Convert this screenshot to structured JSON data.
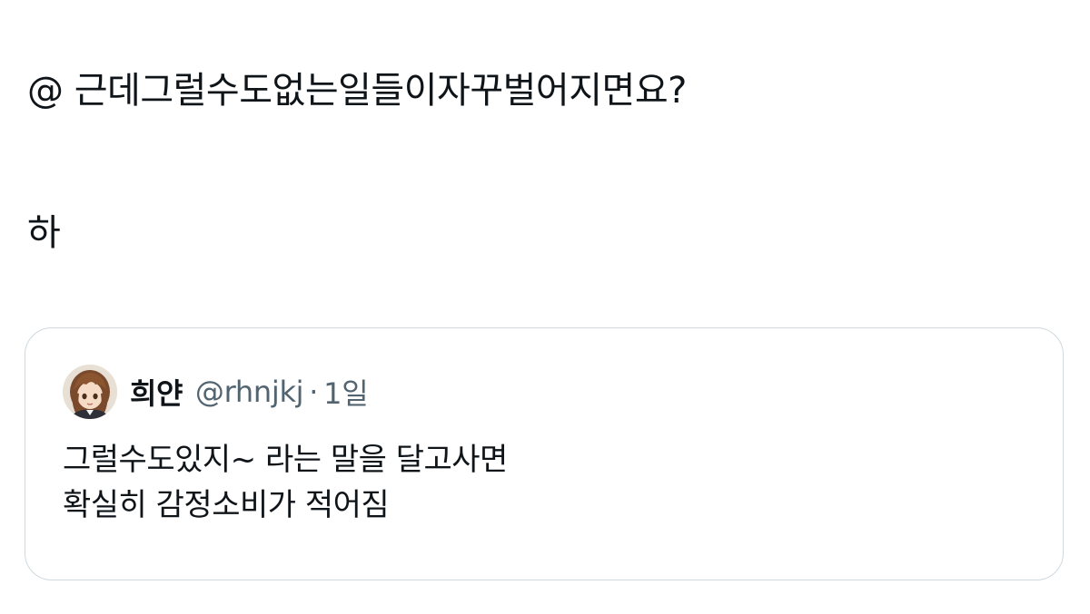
{
  "tweet": {
    "lines": [
      "@ 근데그럴수도없는일들이자꾸벌어지면요?",
      "하"
    ]
  },
  "quoted_tweet": {
    "author_name": "희얀",
    "author_handle": "@rhnjkj",
    "separator": "·",
    "time": "1일",
    "avatar_icon": "anime-character-avatar",
    "body_lines": [
      "그럴수도있지~ 라는 말을 달고사면",
      "확실히 감정소비가 적어짐"
    ]
  },
  "colors": {
    "text_primary": "#0f1419",
    "text_secondary": "#536471",
    "card_border": "#cfd9de",
    "background": "#ffffff"
  }
}
